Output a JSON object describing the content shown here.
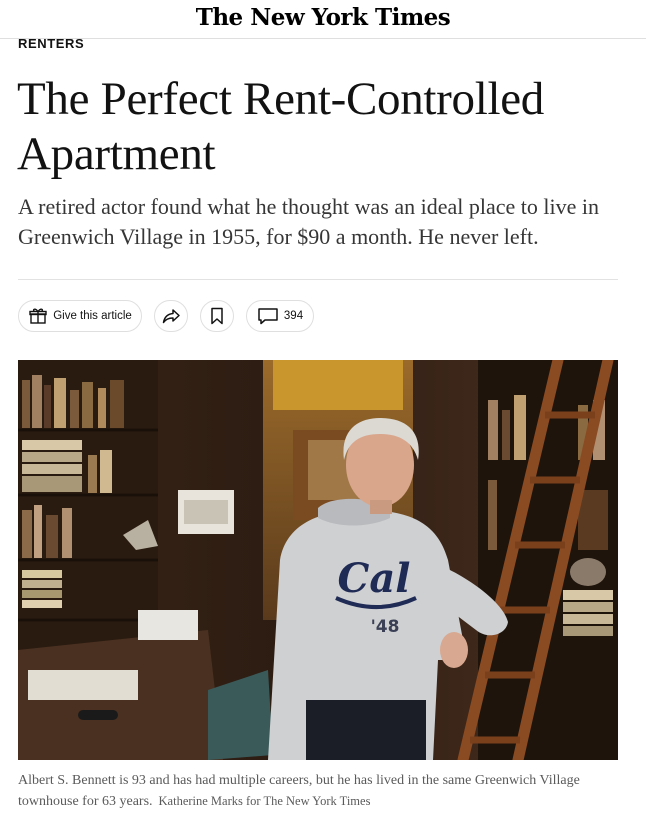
{
  "masthead": {
    "logo": "The New York Times"
  },
  "article": {
    "kicker": "RENTERS",
    "headline": "The Perfect Rent-Controlled Apartment",
    "summary": "A retired actor found what he thought was an ideal place to live in Greenwich Village in 1955, for $90 a month. He never left."
  },
  "share_bar": {
    "gift_label": "Give this article",
    "gift_icon": "gift-icon",
    "share_icon": "share-icon",
    "bookmark_icon": "bookmark-icon",
    "comment_icon": "comment-icon",
    "comment_count": "394"
  },
  "photo": {
    "sweatshirt_text": "Cal",
    "sweatshirt_year": "'48"
  },
  "caption": {
    "text": "Albert S. Bennett is 93 and has had multiple careers, but he has lived in the same Greenwich Village townhouse for 63 years.",
    "credit": "Katherine Marks for The New York Times"
  }
}
